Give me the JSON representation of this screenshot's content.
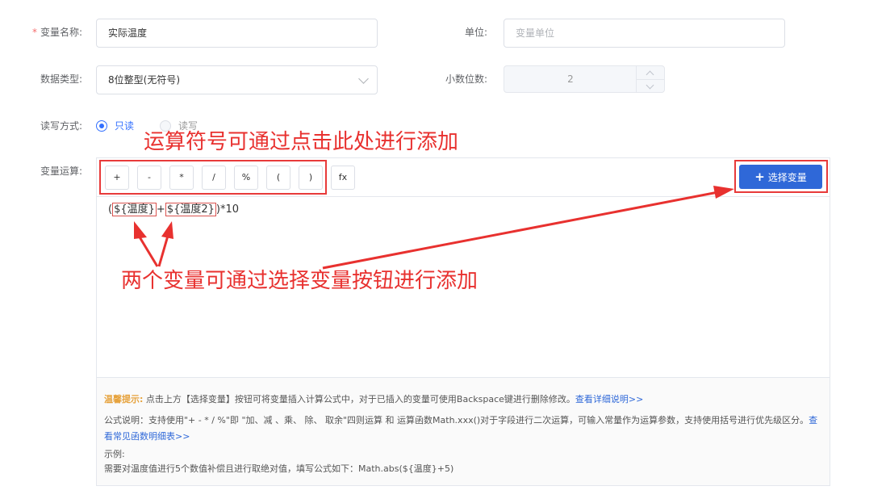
{
  "form": {
    "name_label": "变量名称:",
    "name_value": "实际温度",
    "unit_label": "单位:",
    "unit_placeholder": "变量单位",
    "type_label": "数据类型:",
    "type_value": "8位整型(无符号)",
    "decimal_label": "小数位数:",
    "decimal_value": "2",
    "rw_label": "读写方式:",
    "rw_options": [
      {
        "label": "只读",
        "selected": true
      },
      {
        "label": "读写",
        "selected": false
      }
    ],
    "calc_label": "变量运算:"
  },
  "editor": {
    "operators": [
      "+",
      "-",
      "*",
      "/",
      "%",
      "(",
      ")"
    ],
    "fx_label": "fx",
    "select_var_label": "选择变量",
    "select_var_icon": "plus-icon",
    "formula": {
      "open": "(",
      "var1": "${温度}",
      "plus": "+",
      "var2": "${温度2}",
      "tail": ")*10"
    }
  },
  "annotations": {
    "operators_note": "运算符号可通过点击此处进行添加",
    "variables_note": "两个变量可通过选择变量按钮进行添加"
  },
  "tips": {
    "title": "温馨提示:",
    "line1": "点击上方【选择变量】按钮可将变量插入计算公式中，对于已插入的变量可使用Backspace键进行删除修改。",
    "line1_link": "查看详细说明>>",
    "line2": "公式说明：支持使用\"+ - * / %\"即 \"加、减 、乘、 除、 取余\"四则运算 和 运算函数Math.xxx()对于字段进行二次运算，可输入常量作为运算参数，支持使用括号进行优先级区分。",
    "line2_link": "查看常见函数明细表>>",
    "example_label": "示例:",
    "example_text": "需要对温度值进行5个数值补偿且进行取绝对值，填写公式如下：Math.abs(${温度}+5)"
  },
  "colors": {
    "accent": "#2f68d8",
    "annotation_red": "#e8312f",
    "required": "#f56c6c",
    "tip_title": "#e6a23c"
  }
}
